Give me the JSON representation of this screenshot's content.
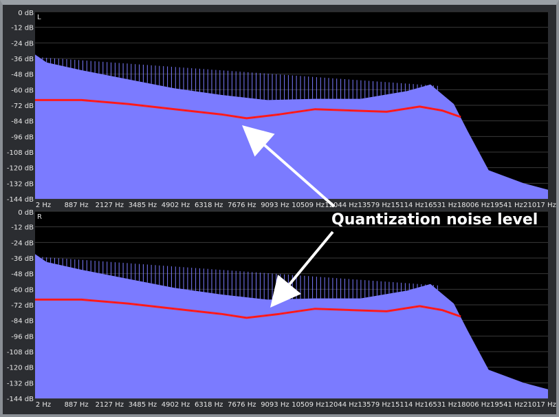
{
  "chart_data": [
    {
      "type": "area",
      "title": "",
      "channel_label": "L",
      "ylabel": "",
      "xlabel": "",
      "yticks": [
        "0 dB",
        "-12 dB",
        "-24 dB",
        "-36 dB",
        "-48 dB",
        "-60 dB",
        "-72 dB",
        "-84 dB",
        "-96 dB",
        "-108 dB",
        "-120 dB",
        "-132 dB",
        "-144 dB"
      ],
      "xticks": [
        "2 Hz",
        "887 Hz",
        "2127 Hz",
        "3485 Hz",
        "4902 Hz",
        "6318 Hz",
        "7676 Hz",
        "9093 Hz",
        "10509 Hz",
        "12044 Hz",
        "13579 Hz",
        "15114 Hz",
        "16531 Hz",
        "18006 Hz",
        "19541 Hz",
        "21017 Hz"
      ],
      "ylim": [
        -144,
        0
      ],
      "xlim": [
        2,
        22050
      ],
      "spectrum": {
        "x": [
          2,
          500,
          2000,
          4000,
          6000,
          8000,
          10000,
          12000,
          14000,
          16000,
          17000,
          18000,
          18600,
          19500,
          21000,
          22050
        ],
        "y": [
          -33,
          -39,
          -45,
          -52,
          -59,
          -64,
          -68,
          -67,
          -67,
          -61,
          -56,
          -71,
          -92,
          -122,
          -132,
          -137
        ]
      },
      "noise_level": {
        "name": "Quantization noise level",
        "x": [
          2,
          2000,
          4000,
          6000,
          8000,
          9093,
          10509,
          12044,
          13579,
          15114,
          16531,
          17500,
          18300
        ],
        "y": [
          -68,
          -68,
          -71,
          -75,
          -79,
          -82,
          -79,
          -75,
          -76,
          -77,
          -73,
          -76,
          -81
        ]
      },
      "spikes": {
        "x_start": 150,
        "x_end": 17300,
        "count": 100,
        "peak_start": -35,
        "peak_end": -57
      },
      "colors": {
        "background": "#000000",
        "fill": "#7b7bff",
        "line": "#ff1a1a",
        "grid": "#3a3a3a"
      }
    },
    {
      "type": "area",
      "title": "",
      "channel_label": "R",
      "ylabel": "",
      "xlabel": "",
      "yticks": [
        "0 dB",
        "-12 dB",
        "-24 dB",
        "-36 dB",
        "-48 dB",
        "-60 dB",
        "-72 dB",
        "-84 dB",
        "-96 dB",
        "-108 dB",
        "-120 dB",
        "-132 dB",
        "-144 dB"
      ],
      "xticks": [
        "2 Hz",
        "887 Hz",
        "2127 Hz",
        "3485 Hz",
        "4902 Hz",
        "6318 Hz",
        "7676 Hz",
        "9093 Hz",
        "10509 Hz",
        "12044 Hz",
        "13579 Hz",
        "15114 Hz",
        "16531 Hz",
        "18006 Hz",
        "19541 Hz",
        "21017 Hz"
      ],
      "ylim": [
        -144,
        0
      ],
      "xlim": [
        2,
        22050
      ],
      "spectrum": {
        "x": [
          2,
          500,
          2000,
          4000,
          6000,
          8000,
          10000,
          12000,
          14000,
          16000,
          17000,
          18000,
          18600,
          19500,
          21000,
          22050
        ],
        "y": [
          -33,
          -39,
          -45,
          -52,
          -59,
          -64,
          -68,
          -67,
          -67,
          -61,
          -56,
          -71,
          -92,
          -122,
          -132,
          -137
        ]
      },
      "noise_level": {
        "name": "Quantization noise level",
        "x": [
          2,
          2000,
          4000,
          6000,
          8000,
          9093,
          10509,
          12044,
          13579,
          15114,
          16531,
          17500,
          18300
        ],
        "y": [
          -68,
          -68,
          -71,
          -75,
          -79,
          -82,
          -79,
          -75,
          -76,
          -77,
          -73,
          -76,
          -81
        ]
      },
      "spikes": {
        "x_start": 150,
        "x_end": 17300,
        "count": 100,
        "peak_start": -35,
        "peak_end": -57
      },
      "colors": {
        "background": "#000000",
        "fill": "#7b7bff",
        "line": "#ff1a1a",
        "grid": "#3a3a3a"
      }
    }
  ],
  "annotation": {
    "text": "Quantization noise level",
    "arrows": 2,
    "color": "#ffffff"
  }
}
